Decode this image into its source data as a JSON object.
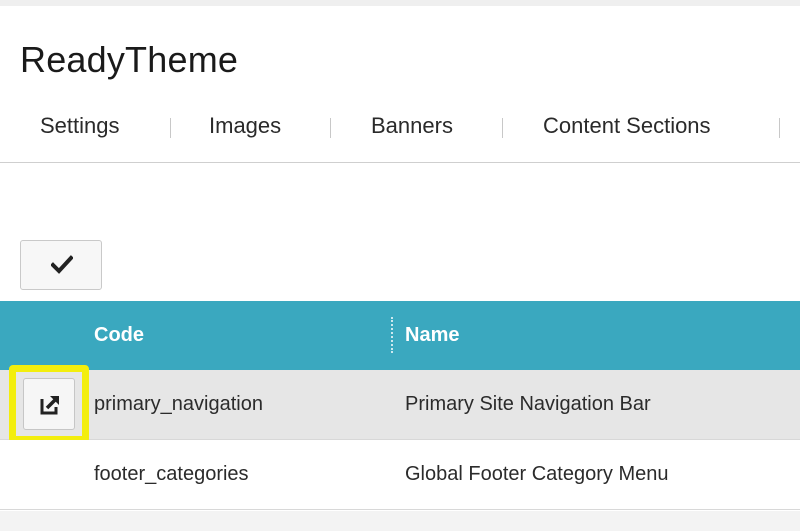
{
  "page": {
    "title": "ReadyTheme"
  },
  "tabs": [
    {
      "label": "Settings"
    },
    {
      "label": "Images"
    },
    {
      "label": "Banners"
    },
    {
      "label": "Content Sections"
    }
  ],
  "toolbar": {
    "confirm_icon": "checkmark-icon"
  },
  "table": {
    "columns": [
      {
        "label": "Code"
      },
      {
        "label": "Name"
      }
    ],
    "rows": [
      {
        "code": "primary_navigation",
        "name": "Primary Site Navigation Bar",
        "action_icon": "open-external-icon",
        "highlighted": true
      },
      {
        "code": "footer_categories",
        "name": "Global Footer Category Menu",
        "highlighted": false
      }
    ]
  },
  "colors": {
    "header_bg": "#3aa8bf",
    "highlight_border": "#f3ee0c",
    "selected_row_bg": "#e6e6e6"
  }
}
